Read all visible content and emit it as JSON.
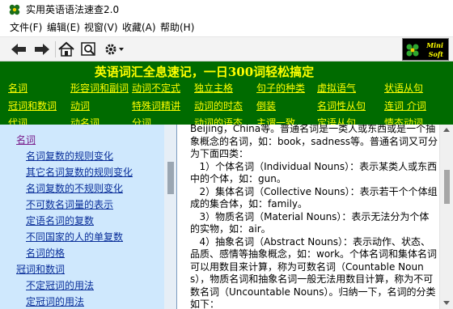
{
  "window": {
    "title": "实用英语语法速查2.0",
    "icon": "app-logo-icon"
  },
  "menu": [
    {
      "label": "文件(F)"
    },
    {
      "label": "编辑(E)"
    },
    {
      "label": "视窗(V)"
    },
    {
      "label": "收藏(A)"
    },
    {
      "label": "帮助(H)"
    }
  ],
  "toolbar": {
    "buttons": [
      "back-arrow-icon",
      "forward-arrow-icon",
      "home-icon",
      "find-icon",
      "settings-icon"
    ],
    "logo_line1": "Mini",
    "logo_line2": "Soft"
  },
  "banner": {
    "title": "英语词汇全息速记，一日300词轻松搞定",
    "background": "#006b00",
    "text_color": "#ffff00",
    "categories": [
      [
        "名词",
        "形容词和副词",
        "动词不定式",
        "独立主格",
        "句子的种类",
        "虚拟语气",
        "状语从句"
      ],
      [
        "冠词和数词",
        "动词",
        "特殊词精讲",
        "动词的时态",
        "倒装",
        "名词性从句",
        "连词 介词"
      ],
      [
        "代词",
        "动名词",
        "分词",
        "动词的语态",
        "主谓一致",
        "定语从句",
        "情态动词"
      ]
    ]
  },
  "nav": {
    "items": [
      {
        "label": "名词",
        "active": true
      },
      {
        "label": "名词复数的规则变化",
        "active": false
      },
      {
        "label": "其它名词复数的规则变化",
        "active": false
      },
      {
        "label": "名词复数的不规则变化",
        "active": false
      },
      {
        "label": "不可数名词量的表示",
        "active": false
      },
      {
        "label": "定语名词的复数",
        "active": false
      },
      {
        "label": "不同国家的人的单复数",
        "active": false
      },
      {
        "label": "名词的格",
        "active": false
      },
      {
        "label": "冠词和数词",
        "active": false
      },
      {
        "label": "不定冠词的用法",
        "active": false
      },
      {
        "label": "定冠词的用法",
        "active": false
      }
    ]
  },
  "content": {
    "text": "Beijing，China等。普通名词是一类人或东西或是一个抽象概念的名词，如：book，sadness等。普通名词又可分为下面四类：\n   1）个体名词（Individual Nouns）：表示某类人或东西中的个体，如：gun。\n   2）集体名词（Collective Nouns）：表示若干个个体组成的集合体，如：family。\n   3）物质名词（Material Nouns）：表示无法分为个体的实物，如：air。\n   4）抽象名词（Abstract Nouns）：表示动作、状态、品质、感情等抽象概念，如：work。个体名词和集体名词可以用数目来计算，称为可数名词（Countable Nouns），物质名词和抽象名词一般无法用数目计算，称为不可数名词（Uncountable Nouns）。归纳一下，名词的分类如下："
  }
}
